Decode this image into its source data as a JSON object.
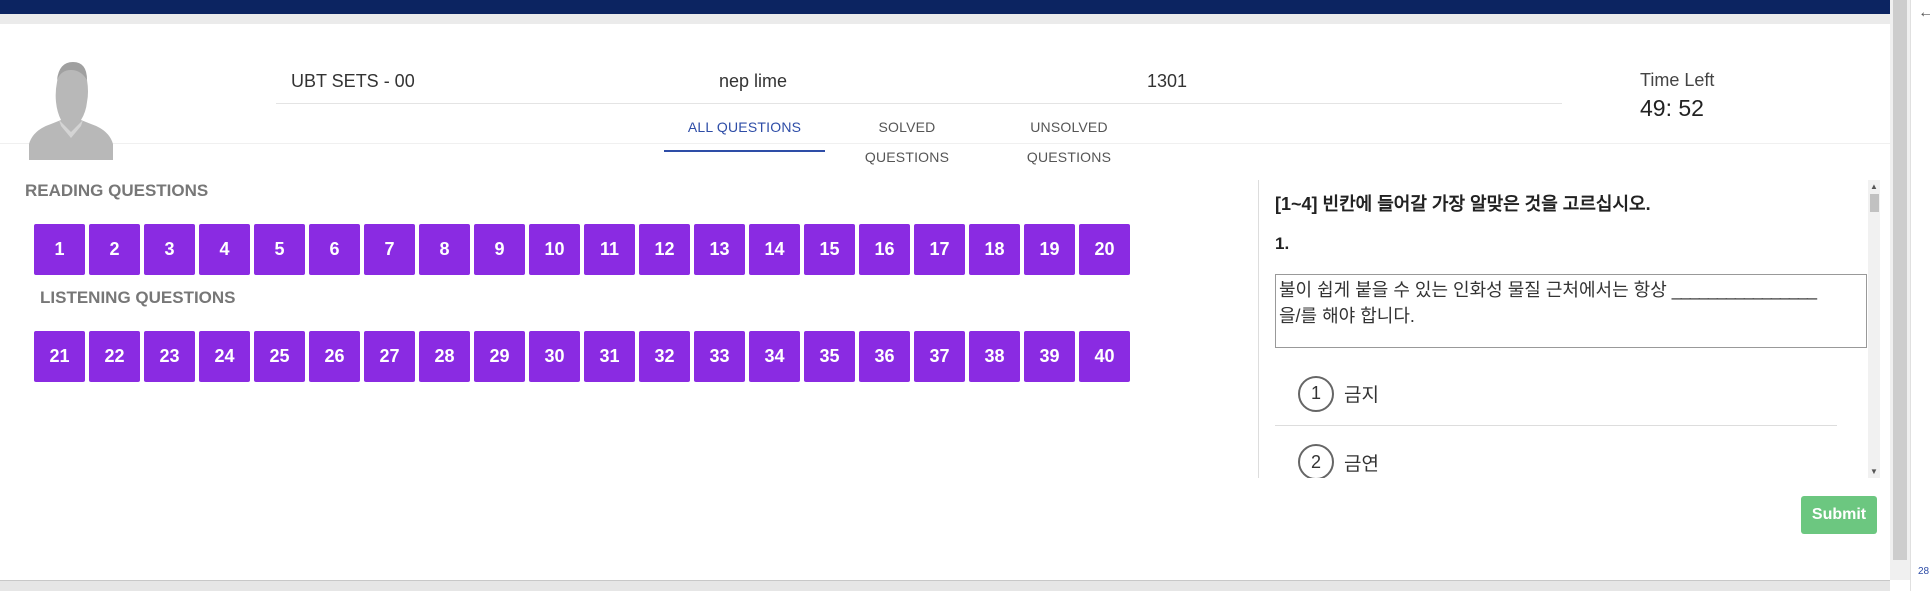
{
  "header": {
    "set_name": "UBT SETS - 00",
    "user_name": "nep lime",
    "code": "1301",
    "timer_label": "Time Left",
    "timer_value": "49: 52"
  },
  "tabs": [
    {
      "label": "ALL QUESTIONS",
      "active": true
    },
    {
      "label": "SOLVED QUESTIONS",
      "active": false
    },
    {
      "label": "UNSOLVED QUESTIONS",
      "active": false
    }
  ],
  "reading": {
    "title": "READING QUESTIONS",
    "numbers": [
      "1",
      "2",
      "3",
      "4",
      "5",
      "6",
      "7",
      "8",
      "9",
      "10",
      "11",
      "12",
      "13",
      "14",
      "15",
      "16",
      "17",
      "18",
      "19",
      "20"
    ]
  },
  "listening": {
    "title": "LISTENING QUESTIONS",
    "numbers": [
      "21",
      "22",
      "23",
      "24",
      "25",
      "26",
      "27",
      "28",
      "29",
      "30",
      "31",
      "32",
      "33",
      "34",
      "35",
      "36",
      "37",
      "38",
      "39",
      "40"
    ]
  },
  "question": {
    "instruction": "[1~4] 빈칸에 들어갈 가장 알맞은 것을 고르십시오.",
    "number": "1.",
    "text_line1": "불이 쉽게 붙을 수 있는 인화성 물질 근처에서는 항상",
    "blank": "________________",
    "text_line2": "을/를 해야 합니다.",
    "options": [
      {
        "num": "1",
        "text": "금지"
      },
      {
        "num": "2",
        "text": "금연"
      }
    ]
  },
  "submit_label": "Submit",
  "side_number": "28",
  "colors": {
    "top_bar": "#0c2461",
    "question_button": "#8a2be2",
    "active_tab": "#2e4da7",
    "submit": "#6cc780"
  }
}
